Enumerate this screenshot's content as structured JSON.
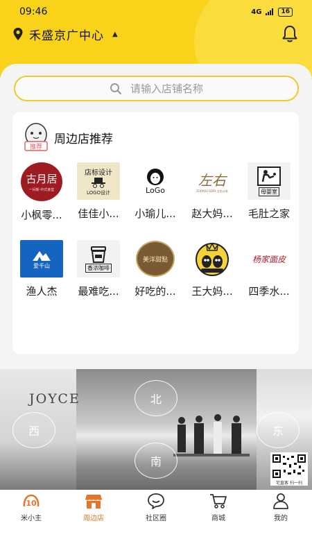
{
  "status_bar": {
    "time": "09:46",
    "network": "4G",
    "battery": "16"
  },
  "header": {
    "location": "禾盛京广中心"
  },
  "search": {
    "placeholder": "请输入店铺名称"
  },
  "section": {
    "title": "周边店推荐",
    "mascot_text": "推荐"
  },
  "stores": [
    {
      "name": "小枫零...",
      "logo_text": "古月居",
      "logo_sub": "一间新·中式食堂"
    },
    {
      "name": "佳佳小...",
      "logo_text": "店标设计",
      "logo_sub": "LOGO设计"
    },
    {
      "name": "小瑜儿...",
      "logo_text": "LoGo"
    },
    {
      "name": "赵大妈...",
      "logo_text": "左右",
      "logo_sub": "ZUOYOU SOFA 左右沙发"
    },
    {
      "name": "毛肚之家",
      "logo_text": "母婴室"
    },
    {
      "name": "渔人杰",
      "logo_text": "爱千山"
    },
    {
      "name": "最难吃...",
      "logo_text": "香浓咖啡"
    },
    {
      "name": "好吃的...",
      "logo_text": "美洋甜點"
    },
    {
      "name": "王大妈...",
      "logo_text": ""
    },
    {
      "name": "四季水...",
      "logo_text": "杨家面皮"
    }
  ],
  "panorama": {
    "brand": "JOYCE",
    "directions": {
      "north": "北",
      "south": "南",
      "west": "西",
      "east": "东"
    },
    "qr_caption": "宅直客 扫一扫"
  },
  "tabs": [
    {
      "label": "米小主",
      "icon": "brand-logo-icon",
      "active": false
    },
    {
      "label": "周边店",
      "icon": "store-icon",
      "active": true
    },
    {
      "label": "社区圈",
      "icon": "chat-bubble-icon",
      "active": false
    },
    {
      "label": "商城",
      "icon": "cart-icon",
      "active": false
    },
    {
      "label": "我的",
      "icon": "user-icon",
      "active": false
    }
  ],
  "colors": {
    "brand_yellow": "#f9d21a",
    "active_tab": "#e8732a"
  }
}
